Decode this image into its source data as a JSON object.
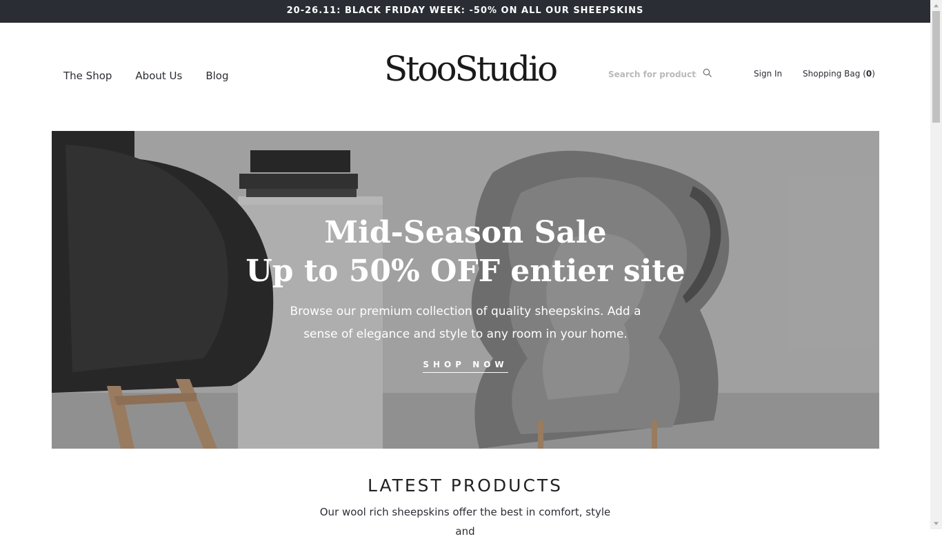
{
  "announcement": "20-26.11: BLACK FRIDAY WEEK: -50% ON ALL OUR SHEEPSKINS",
  "nav": {
    "items": [
      "The Shop",
      "About Us",
      "Blog"
    ]
  },
  "logo_text": "StooStudio",
  "search": {
    "placeholder": "Search for products",
    "icon": "search-icon"
  },
  "account": {
    "sign_in": "Sign In"
  },
  "bag": {
    "label": "Shopping Bag (",
    "count": "0",
    "close": ")"
  },
  "hero": {
    "title_line1": "Mid-Season Sale",
    "title_line2": "Up to 50% OFF entier site",
    "text": "Browse our premium collection of quality sheepskins. Add a sense of elegance and style to any room in your home.",
    "cta": "SHOP NOW"
  },
  "latest": {
    "heading": "LATEST PRODUCTS",
    "text": "Our wool rich sheepskins offer the best in comfort, style and"
  },
  "colors": {
    "announcement_bg": "#2b2d35",
    "text_dark": "#2b2d35",
    "white": "#ffffff"
  }
}
